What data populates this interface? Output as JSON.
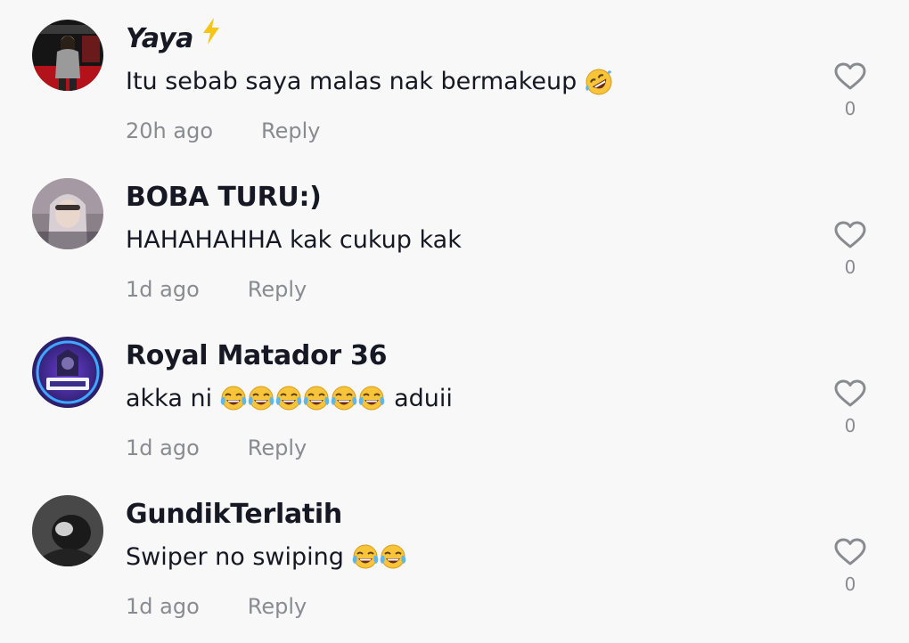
{
  "comments": [
    {
      "username": "Yaya",
      "username_icon": "lightning-bolt-icon",
      "text_before": "Itu sebab saya malas nak bermakeup",
      "emojis": [
        "rolling-on-floor-laughing"
      ],
      "text_after": "",
      "time": "20h ago",
      "reply_label": "Reply",
      "likes": "0"
    },
    {
      "username": "BOBA TURU:)",
      "text_before": "HAHAHAHHA kak cukup kak",
      "emojis": [],
      "text_after": "",
      "time": "1d ago",
      "reply_label": "Reply",
      "likes": "0"
    },
    {
      "username": "Royal Matador 36",
      "text_before": "akka ni",
      "emojis": [
        "tears-of-joy",
        "tears-of-joy",
        "tears-of-joy",
        "tears-of-joy",
        "tears-of-joy",
        "tears-of-joy"
      ],
      "text_after": "aduii",
      "time": "1d ago",
      "reply_label": "Reply",
      "likes": "0"
    },
    {
      "username": "GundikTerlatih",
      "text_before": "Swiper no swiping",
      "emojis": [
        "tears-of-joy",
        "tears-of-joy"
      ],
      "text_after": "",
      "time": "1d ago",
      "reply_label": "Reply",
      "likes": "0"
    }
  ],
  "colors": {
    "background": "#f8f8f8",
    "text": "#161823",
    "secondary": "#8a8b91",
    "bolt": "#f5c518"
  }
}
